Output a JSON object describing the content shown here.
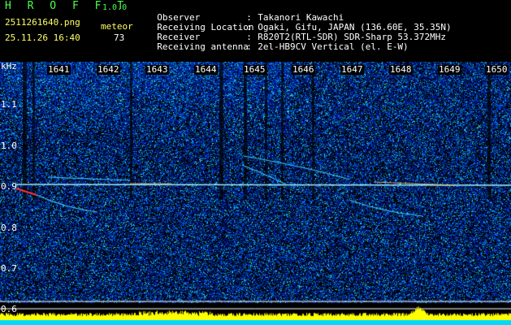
{
  "app": {
    "name": "H R O F F T",
    "version": "1.0.0",
    "filename": "2511261640.png",
    "datetime": "25.11.26 16:40",
    "meteor_label": "meteor",
    "meteor_count": "73"
  },
  "info": [
    {
      "key": "Observer",
      "value": "Takanori Kawachi"
    },
    {
      "key": "Receiving Location",
      "value": "Ogaki, Gifu, JAPAN (136.60E, 35.35N)"
    },
    {
      "key": "Receiver",
      "value": "R820T2(RTL-SDR) SDR-Sharp 53.372MHz"
    },
    {
      "key": "Receiving antenna",
      "value": "2el-HB9CV Vertical (el. E-W)"
    }
  ],
  "separator": ":",
  "axis": {
    "unit": "kHz",
    "time_ticks": [
      "1641",
      "1642",
      "1643",
      "1644",
      "1645",
      "1646",
      "1647",
      "1648",
      "1649",
      "1650"
    ],
    "freq_ticks": [
      "1.1",
      "1.0",
      "0.9",
      "0.8",
      "0.7",
      "0.6"
    ]
  },
  "colors": {
    "brand": "#4cff4c",
    "meta": "#ffff66",
    "background": "#000000",
    "noise": "#0a1a8a",
    "carrier": "#7fe0ff",
    "trace": "#ff4040",
    "signal_bar": "#ffff00",
    "baseline": "#00e0ff"
  }
}
